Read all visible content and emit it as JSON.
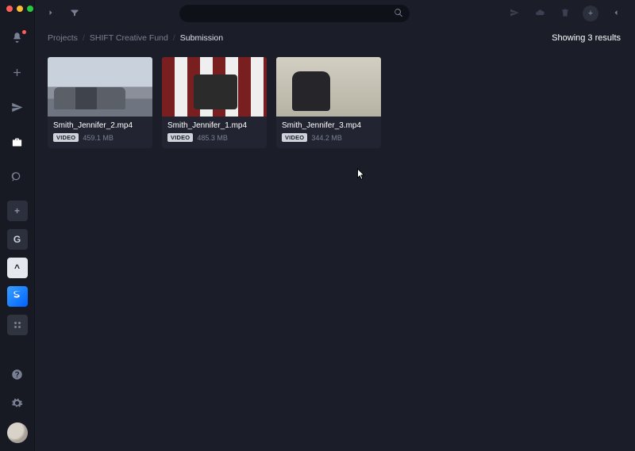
{
  "breadcrumbs": {
    "items": [
      "Projects",
      "SHIFT Creative Fund",
      "Submission"
    ]
  },
  "results_text": "Showing 3 results",
  "files": [
    {
      "name": "Smith_Jennifer_2.mp4",
      "badge": "VIDEO",
      "size": "459.1 MB"
    },
    {
      "name": "Smith_Jennifer_1.mp4",
      "badge": "VIDEO",
      "size": "485.3 MB"
    },
    {
      "name": "Smith_Jennifer_3.mp4",
      "badge": "VIDEO",
      "size": "344.2 MB"
    }
  ],
  "sidebar": {
    "add_label": "+",
    "letter_g": "G",
    "caret": "^"
  }
}
